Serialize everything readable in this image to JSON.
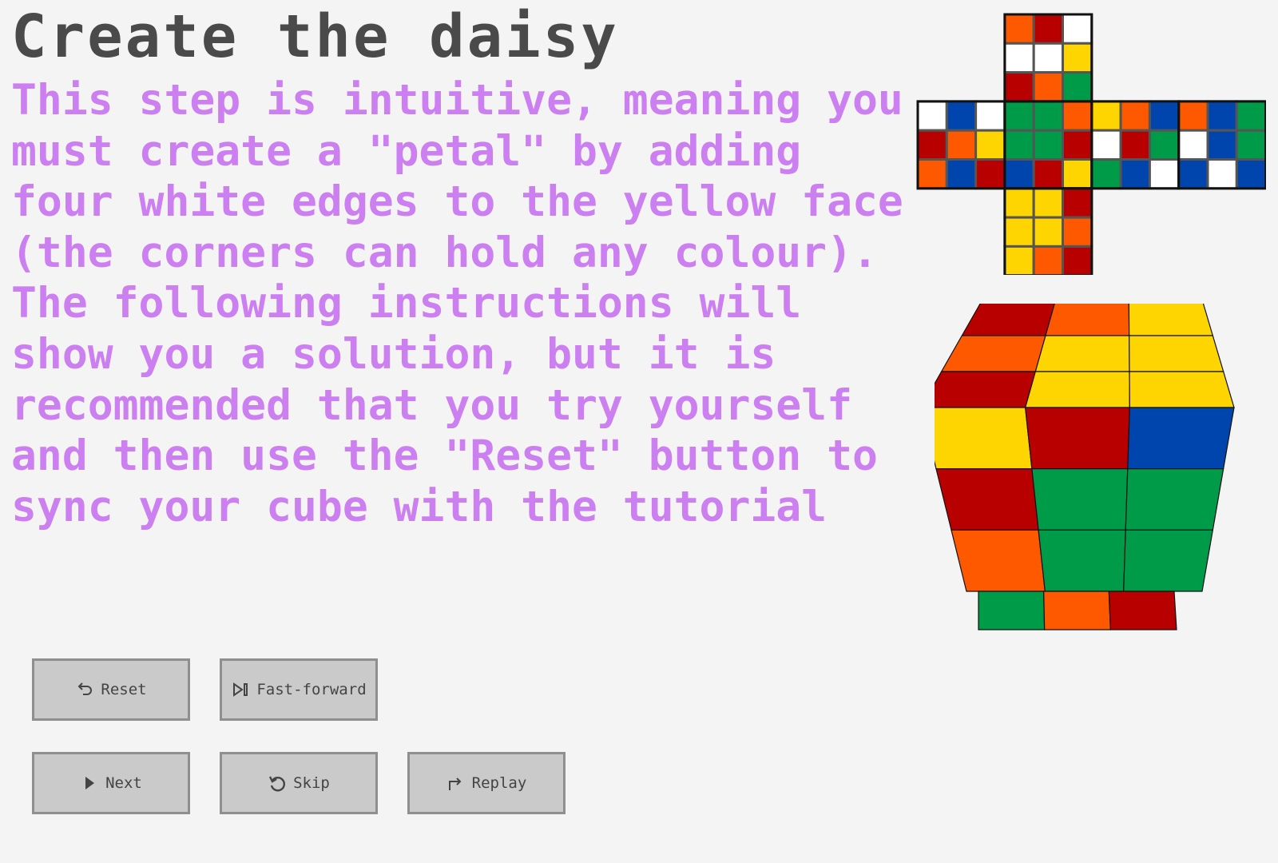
{
  "page": {
    "title": "Create the daisy",
    "instructions": [
      "This step is intuitive, meaning you must create a \"petal\" by adding four white edges to the yellow face (the corners can hold any colour).",
      "The following instructions will show you a solution, but it is recommended that you try yourself and then use the \"Reset\" button to sync your cube with the tutorial"
    ]
  },
  "buttons": {
    "reset": {
      "label": "Reset",
      "icon": "undo-arrow-icon"
    },
    "fast_forward": {
      "label": "Fast-forward",
      "icon": "skip-forward-icon"
    },
    "next": {
      "label": "Next",
      "icon": "play-icon"
    },
    "skip": {
      "label": "Skip",
      "icon": "rotate-icon"
    },
    "replay": {
      "label": "Replay",
      "icon": "share-arrow-icon"
    }
  },
  "colors": {
    "title": "#4a4a4a",
    "instructions": "#cc7ff0",
    "background": "#f4f4f4",
    "button_bg": "#cacaca",
    "button_border": "#8f8f8f",
    "W": "#ffffff",
    "Y": "#ffd500",
    "R": "#b90000",
    "O": "#ff5900",
    "G": "#009b48",
    "B": "#0045ad"
  },
  "cube_net": {
    "up": [
      [
        "O",
        "R",
        "W"
      ],
      [
        "W",
        "W",
        "Y"
      ],
      [
        "R",
        "O",
        "G"
      ]
    ],
    "left": [
      [
        "W",
        "B",
        "W"
      ],
      [
        "R",
        "O",
        "Y"
      ],
      [
        "O",
        "B",
        "R"
      ]
    ],
    "front": [
      [
        "G",
        "G",
        "O"
      ],
      [
        "G",
        "G",
        "R"
      ],
      [
        "B",
        "R",
        "Y"
      ]
    ],
    "right": [
      [
        "Y",
        "O",
        "B"
      ],
      [
        "W",
        "R",
        "G"
      ],
      [
        "G",
        "B",
        "W"
      ]
    ],
    "back": [
      [
        "O",
        "B",
        "G"
      ],
      [
        "W",
        "B",
        "G"
      ],
      [
        "B",
        "W",
        "B"
      ]
    ],
    "down": [
      [
        "Y",
        "Y",
        "R"
      ],
      [
        "Y",
        "Y",
        "O"
      ],
      [
        "Y",
        "O",
        "R"
      ]
    ]
  },
  "cube_3d": {
    "top": [
      [
        "R",
        "O",
        "Y"
      ],
      [
        "O",
        "Y",
        "Y"
      ],
      [
        "R",
        "Y",
        "Y"
      ]
    ],
    "front": [
      [
        "Y",
        "R",
        "B"
      ],
      [
        "R",
        "G",
        "G"
      ],
      [
        "O",
        "G",
        "G"
      ]
    ],
    "bottom_row": [
      "G",
      "O",
      "R"
    ]
  }
}
